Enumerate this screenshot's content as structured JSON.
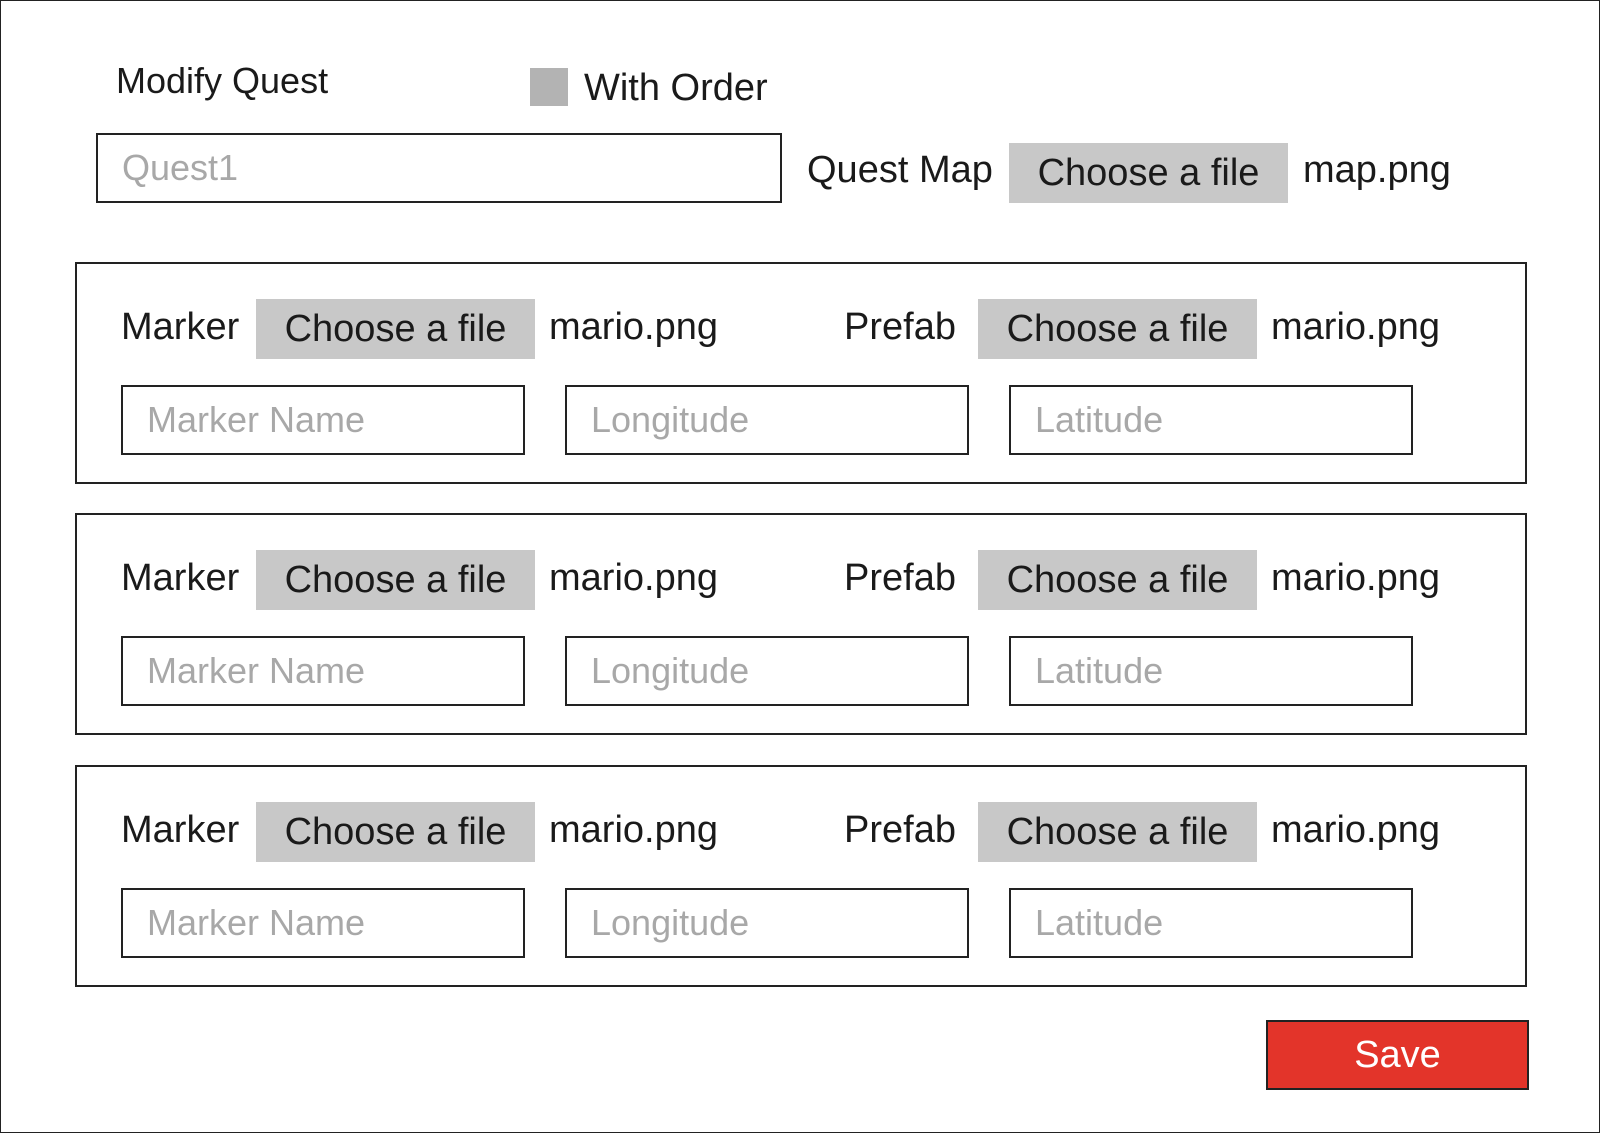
{
  "header": {
    "title": "Modify Quest",
    "with_order_label": "With Order",
    "with_order_checked": false
  },
  "quest": {
    "name_placeholder": "Quest1",
    "map_label": "Quest Map",
    "map_button": "Choose a file",
    "map_file": "map.png"
  },
  "markers": [
    {
      "marker_label": "Marker",
      "marker_button": "Choose a file",
      "marker_file": "mario.png",
      "prefab_label": "Prefab",
      "prefab_button": "Choose a file",
      "prefab_file": "mario.png",
      "name_placeholder": "Marker Name",
      "longitude_placeholder": "Longitude",
      "latitude_placeholder": "Latitude"
    },
    {
      "marker_label": "Marker",
      "marker_button": "Choose a file",
      "marker_file": "mario.png",
      "prefab_label": "Prefab",
      "prefab_button": "Choose a file",
      "prefab_file": "mario.png",
      "name_placeholder": "Marker Name",
      "longitude_placeholder": "Longitude",
      "latitude_placeholder": "Latitude"
    },
    {
      "marker_label": "Marker",
      "marker_button": "Choose a file",
      "marker_file": "mario.png",
      "prefab_label": "Prefab",
      "prefab_button": "Choose a file",
      "prefab_file": "mario.png",
      "name_placeholder": "Marker Name",
      "longitude_placeholder": "Longitude",
      "latitude_placeholder": "Latitude"
    }
  ],
  "actions": {
    "save_label": "Save"
  },
  "colors": {
    "save_button": "#e3342a",
    "file_button": "#c8c8c8",
    "checkbox": "#b3b3b3",
    "placeholder": "#a8a8a8"
  }
}
